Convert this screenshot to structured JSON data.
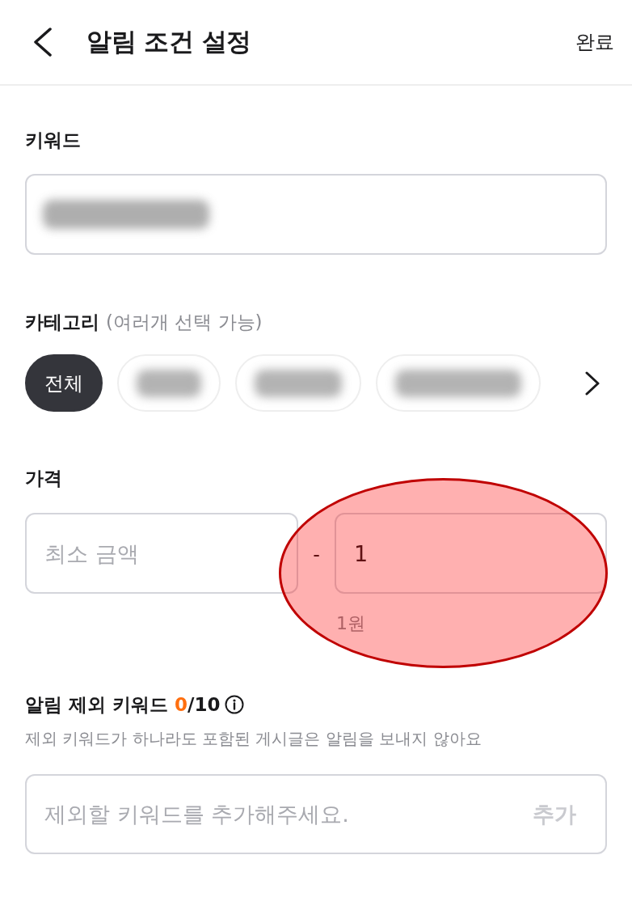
{
  "header": {
    "title": "알림 조건 설정",
    "done": "완료"
  },
  "keyword": {
    "label": "키워드",
    "field": {
      "redacted": true
    }
  },
  "category": {
    "label": "카테고리",
    "note": "(여러개 선택 가능)",
    "chips": [
      {
        "kind": "text",
        "label": "전체",
        "selected": true
      },
      {
        "kind": "blurred",
        "selected": false
      },
      {
        "kind": "blurred",
        "selected": false
      },
      {
        "kind": "blurred",
        "selected": false
      }
    ]
  },
  "price": {
    "label": "가격",
    "min": {
      "placeholder": "최소 금액"
    },
    "separator": "-",
    "max": {
      "value": "1",
      "hint": "1원",
      "highlighted": true
    }
  },
  "exclude": {
    "title": "알림 제외 키워드",
    "count": "0",
    "limit": "/10",
    "description": "제외 키워드가 하나라도 포함된 게시글은 알림을 보내지 않아요",
    "field": {
      "placeholder": "제외할 키워드를 추가해주세요."
    },
    "add_button": {
      "label": "추가",
      "disabled": true
    }
  }
}
